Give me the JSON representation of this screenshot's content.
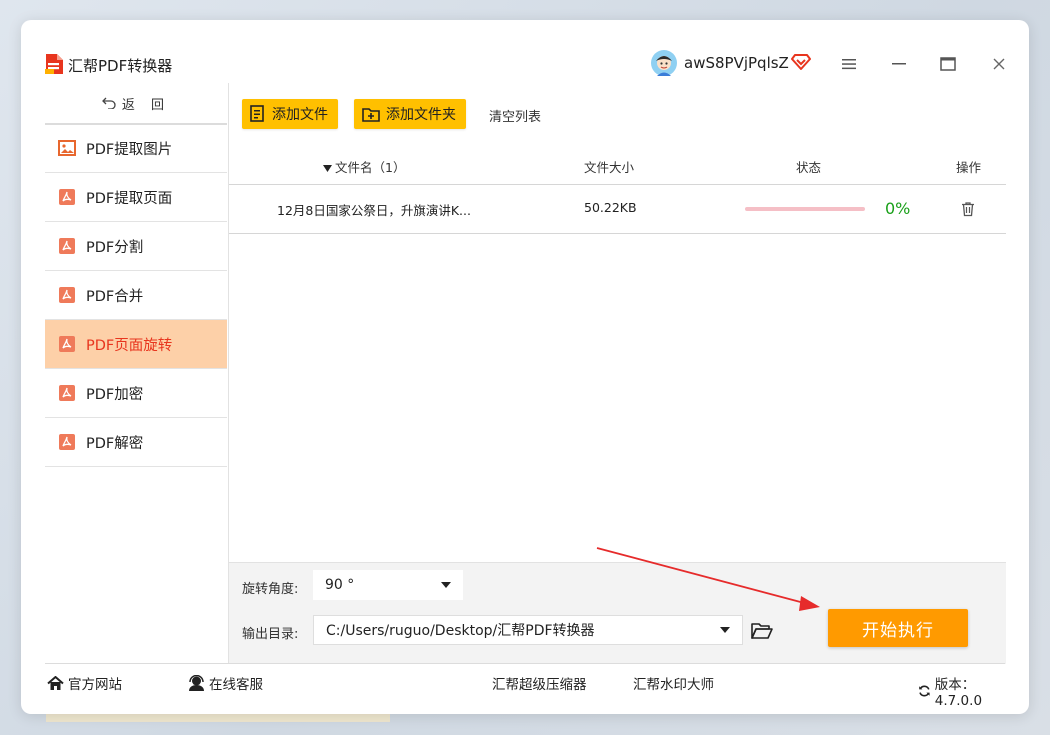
{
  "app": {
    "title": "汇帮PDF转换器"
  },
  "user": {
    "name": "awS8PVjPqlsZ"
  },
  "window_controls": {
    "menu": "menu-icon",
    "minimize": "minimize-icon",
    "maximize": "maximize-icon",
    "close": "close-icon"
  },
  "sidebar": {
    "back_label": "返 回",
    "items": [
      {
        "label": "PDF提取图片",
        "icon": "image-icon",
        "active": false
      },
      {
        "label": "PDF提取页面",
        "icon": "pdf-icon",
        "active": false
      },
      {
        "label": "PDF分割",
        "icon": "pdf-icon",
        "active": false
      },
      {
        "label": "PDF合并",
        "icon": "pdf-icon",
        "active": false
      },
      {
        "label": "PDF页面旋转",
        "icon": "pdf-icon",
        "active": true
      },
      {
        "label": "PDF加密",
        "icon": "pdf-icon",
        "active": false
      },
      {
        "label": "PDF解密",
        "icon": "pdf-icon",
        "active": false
      }
    ]
  },
  "toolbar": {
    "add_file": "添加文件",
    "add_folder": "添加文件夹",
    "clear_list": "清空列表"
  },
  "table": {
    "headers": {
      "filename": "文件名（1）",
      "size": "文件大小",
      "status": "状态",
      "action": "操作"
    },
    "rows": [
      {
        "filename": "12月8日国家公祭日，升旗演讲K...",
        "size": "50.22KB",
        "progress": 0,
        "progress_text": "0%"
      }
    ]
  },
  "settings": {
    "rotation_label": "旋转角度:",
    "rotation_value": "90 °",
    "output_label": "输出目录:",
    "output_value": "C:/Users/ruguo/Desktop/汇帮PDF转换器"
  },
  "start_button": "开始执行",
  "footer": {
    "website": "官方网站",
    "support": "在线客服",
    "link1": "汇帮超级压缩器",
    "link2": "汇帮水印大师",
    "version": "版本：4.7.0.0"
  },
  "colors": {
    "accent": "#ff9a00",
    "toolbar_button": "#ffc000",
    "active_nav_bg": "#fdd0a8",
    "active_nav_text": "#e8351e",
    "progress_text": "#1aa01a"
  }
}
